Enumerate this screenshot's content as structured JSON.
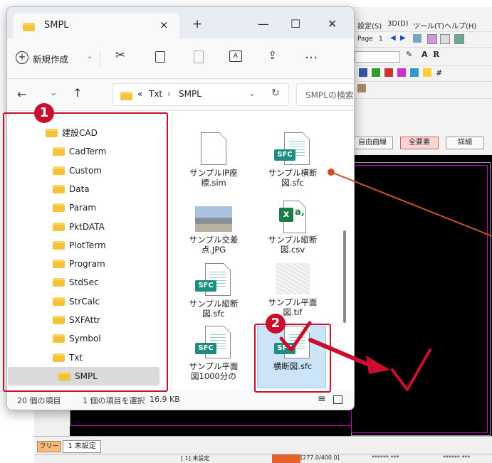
{
  "cad": {
    "menu": [
      "設定(S)",
      "3D(D)",
      "ツール(T)",
      "ヘルプ(H)"
    ],
    "page_label": "Page",
    "page_number": "1",
    "buttons": [
      "自由曲線",
      "全要素",
      "詳細"
    ],
    "layer_tab_free": "フリー",
    "layer_tab_unset": "1 未設定",
    "status": [
      "[ 1] 未設定",
      "[277.0/400.0]",
      "******.***",
      "******.***"
    ]
  },
  "window": {
    "tab_title": "SMPL",
    "tab_close": "×",
    "new_tab": "+",
    "minimize": "—",
    "maximize": "☐",
    "close": "✕",
    "new_button": "新規作成",
    "more": "…",
    "breadcrumb": [
      "«",
      "Txt",
      "›",
      "SMPL"
    ],
    "search_placeholder": "SMPLの検索"
  },
  "nav": {
    "items": [
      {
        "label": "建設CAD",
        "indent": 0
      },
      {
        "label": "CadTerm",
        "indent": 1
      },
      {
        "label": "Custom",
        "indent": 1
      },
      {
        "label": "Data",
        "indent": 1
      },
      {
        "label": "Param",
        "indent": 1
      },
      {
        "label": "PktDATA",
        "indent": 1
      },
      {
        "label": "PlotTerm",
        "indent": 1
      },
      {
        "label": "Program",
        "indent": 1
      },
      {
        "label": "StdSec",
        "indent": 1
      },
      {
        "label": "StrCalc",
        "indent": 1
      },
      {
        "label": "SXFAttr",
        "indent": 1
      },
      {
        "label": "Symbol",
        "indent": 1
      },
      {
        "label": "Txt",
        "indent": 1
      },
      {
        "label": "SMPL",
        "indent": 2
      }
    ]
  },
  "files": [
    {
      "name": "サンプルIP座標.sim",
      "line1": "サンプルIP座",
      "line2": "標.sim",
      "kind": "doc"
    },
    {
      "name": "サンプル横断図.sfc",
      "line1": "サンプル横断",
      "line2": "図.sfc",
      "kind": "sfc"
    },
    {
      "name": "サンプル交差点.JPG",
      "line1": "サンプル交差",
      "line2": "点.JPG",
      "kind": "jpg"
    },
    {
      "name": "サンプル縦断図.csv",
      "line1": "サンプル縦断",
      "line2": "図.csv",
      "kind": "csv"
    },
    {
      "name": "サンプル縦断図.sfc",
      "line1": "サンプル縦断",
      "line2": "図.sfc",
      "kind": "sfc"
    },
    {
      "name": "サンプル平面図.tif",
      "line1": "サンプル平面",
      "line2": "図.tif",
      "kind": "tif"
    },
    {
      "name": "サンプル平面図1000分の",
      "line1": "サンプル平面",
      "line2": "図1000分の",
      "kind": "sfc"
    },
    {
      "name": "横断図.sfc",
      "line1": "横断図.sfc",
      "line2": "",
      "kind": "sfc"
    }
  ],
  "badges": {
    "sfc": "SFC",
    "excel": "x",
    "excel_sub": "a,"
  },
  "status": {
    "count": "20 個の項目",
    "selected": "1 個の項目を選択",
    "size": "16.9 KB"
  },
  "annotations": {
    "one": "1",
    "two": "2"
  },
  "colors": {
    "annotation_red": "#c8102e",
    "connector_orange": "#c85028",
    "folder": "#f5c33b",
    "sfc_green": "#1c8d7e"
  }
}
